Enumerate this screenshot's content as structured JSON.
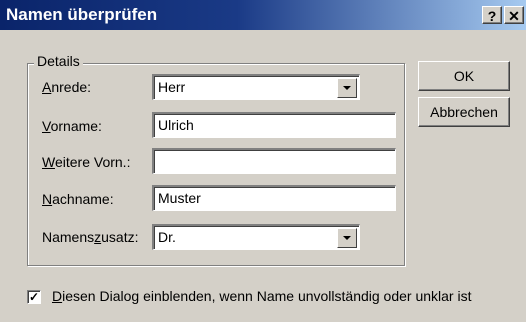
{
  "window": {
    "title": "Namen überprüfen",
    "help_button": "?",
    "close_button": "✕"
  },
  "details": {
    "legend": "Details",
    "fields": [
      {
        "label_key": "A",
        "label_rest": "nrede:",
        "value": "Herr"
      },
      {
        "label_key": "V",
        "label_rest": "orname:",
        "value": "Ulrich"
      },
      {
        "label_key": "W",
        "label_rest": "eitere Vorn.:",
        "value": ""
      },
      {
        "label_key": "N",
        "label_rest": "achname:",
        "value": "Muster"
      },
      {
        "label_pre": "Namens",
        "label_key": "z",
        "label_rest": "usatz:",
        "value": "Dr."
      }
    ]
  },
  "buttons": {
    "ok": "OK",
    "cancel": "Abbrechen"
  },
  "option": {
    "checked_mark": "✓",
    "label_key": "D",
    "label_rest": "iesen Dialog einblenden, wenn Name unvollständig oder unklar ist"
  }
}
